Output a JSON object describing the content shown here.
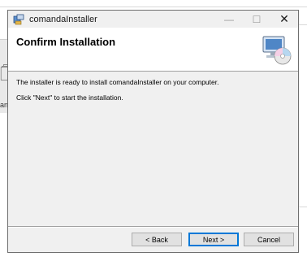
{
  "window": {
    "title": "comandaInstaller",
    "controls": {
      "minimize": "—",
      "maximize": "☐",
      "close": "✕"
    }
  },
  "header": {
    "title": "Confirm Installation",
    "icon": "computer-cd-icon"
  },
  "body": {
    "line1": "The installer is ready to install comandaInstaller on your computer.",
    "line2": "Click \"Next\" to start the installation."
  },
  "buttons": {
    "back": "< Back",
    "next": "Next >",
    "cancel": "Cancel"
  },
  "background": {
    "left_glyph": "🗍",
    "left_text": "an"
  },
  "colors": {
    "accent": "#0078d7",
    "dialog_bg": "#f0f0f0",
    "header_bg": "#ffffff"
  }
}
